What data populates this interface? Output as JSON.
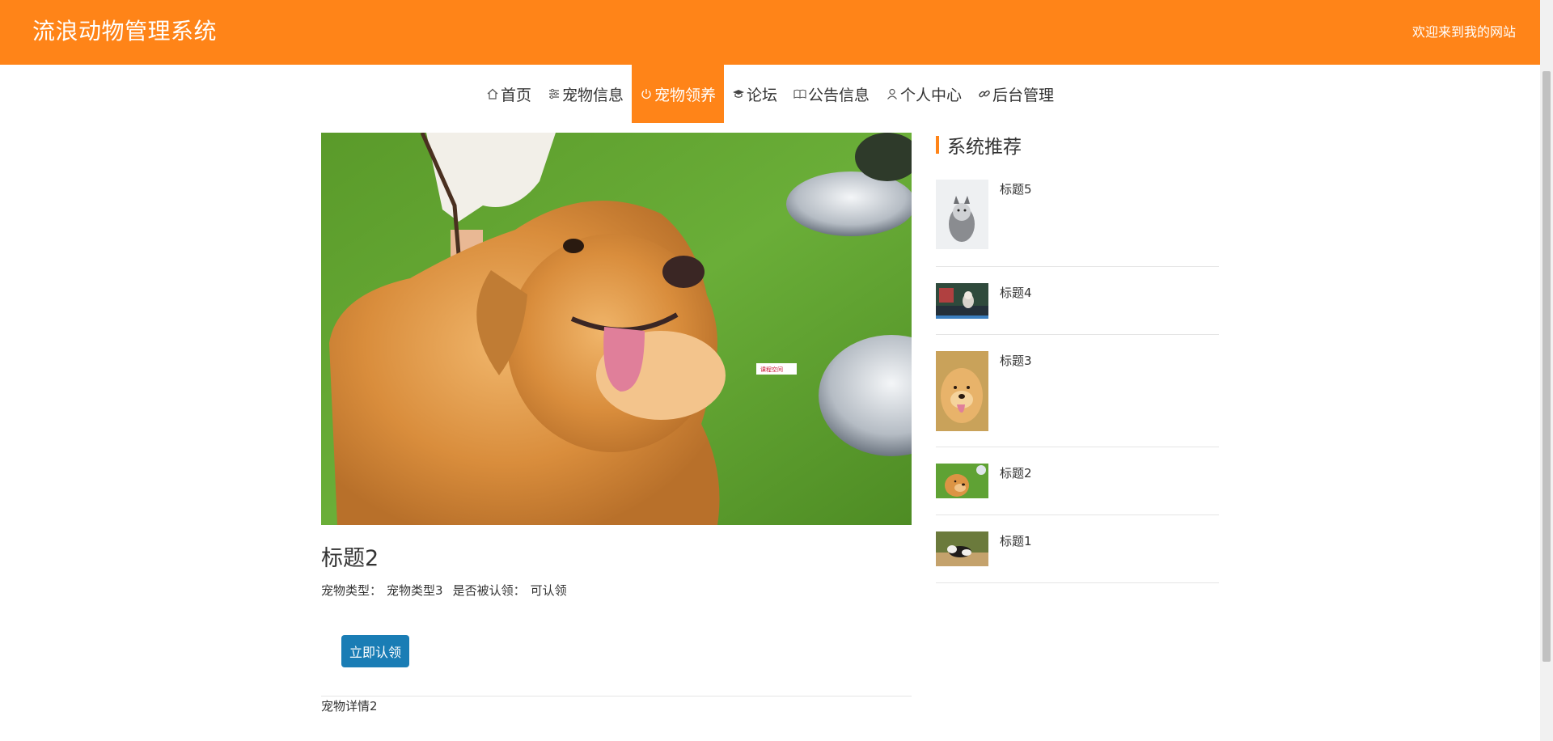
{
  "header": {
    "site_title": "流浪动物管理系统",
    "welcome": "欢迎来到我的网站",
    "brand_color": "#ff8418"
  },
  "nav": {
    "items": [
      {
        "label": "首页",
        "icon": "home-icon"
      },
      {
        "label": "宠物信息",
        "icon": "sliders-icon"
      },
      {
        "label": "宠物领养",
        "icon": "power-icon",
        "active": true
      },
      {
        "label": "论坛",
        "icon": "graduation-cap-icon"
      },
      {
        "label": "公告信息",
        "icon": "book-icon"
      },
      {
        "label": "个人中心",
        "icon": "user-icon"
      },
      {
        "label": "后台管理",
        "icon": "link-icon"
      }
    ]
  },
  "detail": {
    "title": "标题2",
    "pet_type_label": "宠物类型：",
    "pet_type_value": "宠物类型3",
    "adopted_label": "是否被认领：",
    "adopted_value": "可认领",
    "adopt_button": "立即认领",
    "description": "宠物详情2",
    "watermark": "课程空间"
  },
  "sidebar": {
    "title": "系统推荐",
    "items": [
      {
        "label": "标题5",
        "image": "husky-puppy"
      },
      {
        "label": "标题4",
        "image": "dog-street"
      },
      {
        "label": "标题3",
        "image": "golden-retriever"
      },
      {
        "label": "标题2",
        "image": "golden-retriever-grass"
      },
      {
        "label": "标题1",
        "image": "border-collie"
      }
    ]
  },
  "colors": {
    "accent": "#ff8418",
    "button": "#1a7db5"
  }
}
